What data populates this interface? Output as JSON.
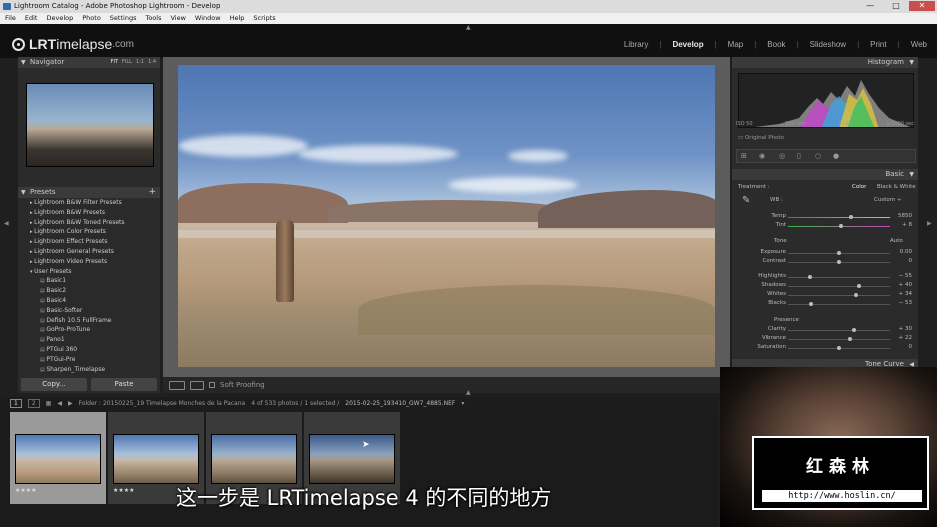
{
  "window": {
    "title": "Lightroom Catalog - Adobe Photoshop Lightroom - Develop",
    "minimize": "—",
    "maximize": "□",
    "close": "✕"
  },
  "menu": [
    "File",
    "Edit",
    "Develop",
    "Photo",
    "Settings",
    "Tools",
    "View",
    "Window",
    "Help",
    "Scripts"
  ],
  "logo": {
    "brand": "LRT",
    "rest": "imelapse",
    "suffix": ".com"
  },
  "modules": [
    "Library",
    "Develop",
    "Map",
    "Book",
    "Slideshow",
    "Print",
    "Web"
  ],
  "active_module": "Develop",
  "left": {
    "navigator": {
      "title": "Navigator",
      "zoom": [
        "FIT",
        "FILL",
        "1:1",
        "1:4"
      ]
    },
    "presets": {
      "title": "Presets",
      "add": "+",
      "folders": [
        "Lightroom B&W Filter Presets",
        "Lightroom B&W Presets",
        "Lightroom B&W Toned Presets",
        "Lightroom Color Presets",
        "Lightroom Effect Presets",
        "Lightroom General Presets",
        "Lightroom Video Presets"
      ],
      "user_folder": "User Presets",
      "user_items": [
        "Basic1",
        "Basic2",
        "Basic4",
        "Basic-Softer",
        "Defish 10.5 FullFrame",
        "GoPro-ProTune",
        "Pano1",
        "PTGui 360",
        "PTGui-Pre",
        "Sharpen_Timelapse"
      ]
    },
    "copy_label": "Copy...",
    "paste_label": "Paste"
  },
  "toolbar": {
    "soft_proofing": "Soft Proofing"
  },
  "right": {
    "histogram": {
      "title": "Histogram",
      "iso": "ISO 50",
      "focal": "100 mm",
      "aperture": "f / 2.8",
      "shutter": "1/1000 sec",
      "original": "Original Photo"
    },
    "basic": {
      "title": "Basic",
      "treatment_label": "Treatment :",
      "color": "Color",
      "bw": "Black & White",
      "wb_label": "WB :",
      "wb_value": "Custom ÷",
      "temp": {
        "label": "Temp",
        "value": "5850",
        "pos": 0.62
      },
      "tint": {
        "label": "Tint",
        "value": "+ 8",
        "pos": 0.52
      },
      "tone_label": "Tone",
      "auto": "Auto",
      "exposure": {
        "label": "Exposure",
        "value": "0.00",
        "pos": 0.5
      },
      "contrast": {
        "label": "Contrast",
        "value": "0",
        "pos": 0.5
      },
      "highlights": {
        "label": "Highlights",
        "value": "− 55",
        "pos": 0.22
      },
      "shadows": {
        "label": "Shadows",
        "value": "+ 40",
        "pos": 0.7
      },
      "whites": {
        "label": "Whites",
        "value": "+ 34",
        "pos": 0.67
      },
      "blacks": {
        "label": "Blacks",
        "value": "− 53",
        "pos": 0.23
      },
      "presence_label": "Presence",
      "clarity": {
        "label": "Clarity",
        "value": "+ 30",
        "pos": 0.65
      },
      "vibrance": {
        "label": "Vibrance",
        "value": "+ 22",
        "pos": 0.61
      },
      "saturation": {
        "label": "Saturation",
        "value": "0",
        "pos": 0.5
      }
    },
    "tone_curve": "Tone Curve"
  },
  "filmbar": {
    "view1": "1",
    "view2": "2",
    "folder": "Folder : 20150225_19 Timelapse Monches de la Pacana",
    "count": "4 of 533 photos / 1 selected /",
    "file": "2015-02-25_193410_GW7_4885.NEF"
  },
  "thumbs": [
    {
      "stars": "★★★★"
    },
    {
      "stars": "★★★★"
    },
    {
      "stars": ""
    },
    {
      "stars": ""
    }
  ],
  "watermark": {
    "title": "红森林",
    "url": "http://www.hoslin.cn/"
  },
  "subtitle": "这一步是 LRTimelapse 4 的不同的地方"
}
